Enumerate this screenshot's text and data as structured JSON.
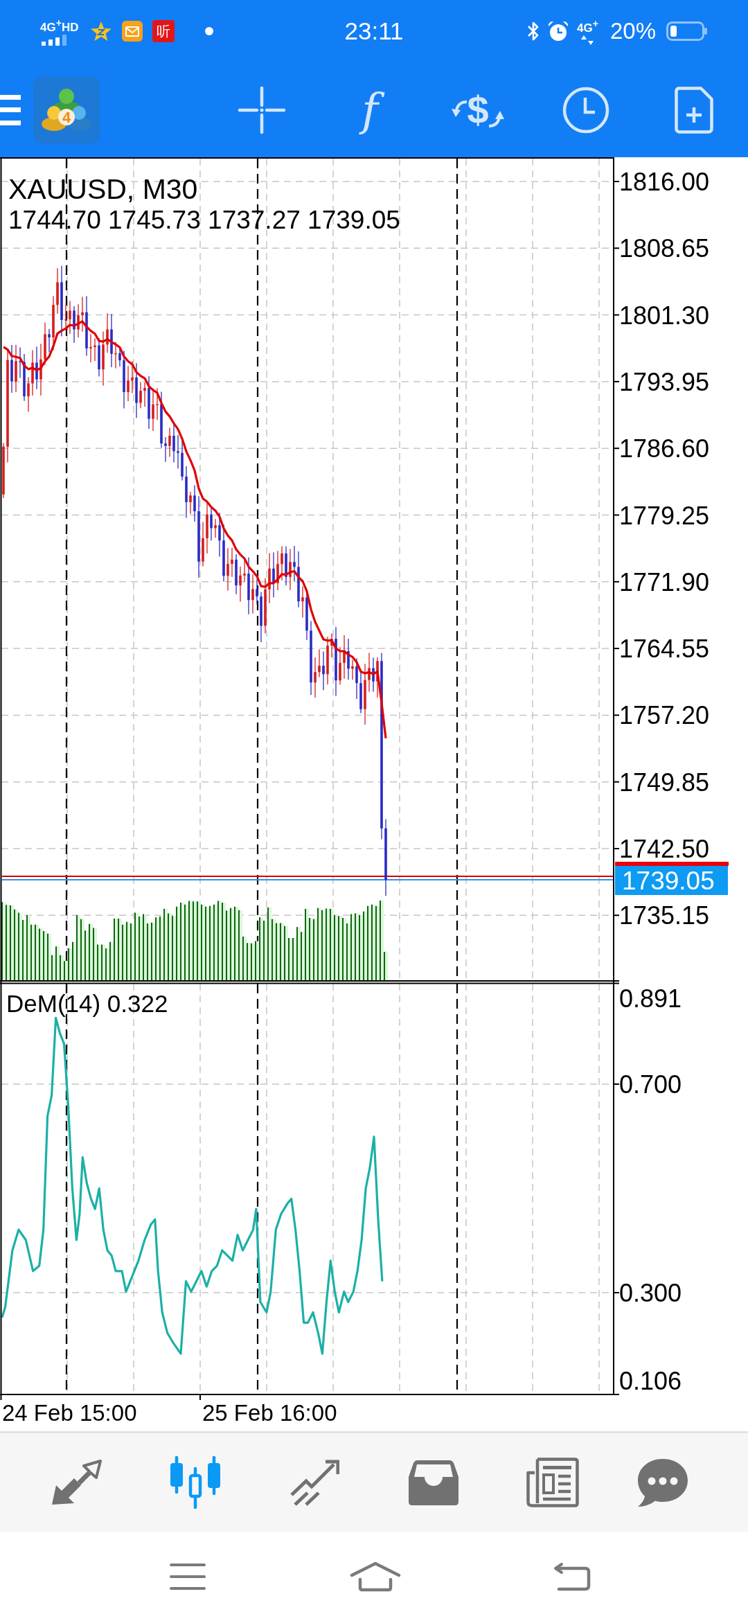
{
  "status_bar": {
    "network_label": "4G$^{+}$HD",
    "notification_badge": "听",
    "time": "23:11",
    "data_label": "4G$^{+}$",
    "battery": "20%"
  },
  "toolbar": {
    "logo_text": "4",
    "function_glyph": "f",
    "trade_glyph": "$"
  },
  "chart": {
    "title": "XAUUSD, M30",
    "ohlc": "1744.70 1745.73 1737.27 1739.05",
    "price_axis": [
      "1816.00",
      "1808.65",
      "1801.30",
      "1793.95",
      "1786.60",
      "1779.25",
      "1771.90",
      "1764.55",
      "1757.20",
      "1749.85",
      "1742.50",
      "1735.15"
    ],
    "current_price": "1739.05",
    "indicator_label": "DeM(14) 0.322",
    "indicator_axis": [
      "0.891",
      "0.700",
      "0.300",
      "0.106"
    ],
    "time_axis": [
      "24 Feb 15:00",
      "25 Feb 16:00"
    ]
  },
  "bottom_nav": [
    {
      "kind": "arrows",
      "selected": false
    },
    {
      "kind": "candles",
      "selected": true
    },
    {
      "kind": "trend",
      "selected": false
    },
    {
      "kind": "tray",
      "selected": false
    },
    {
      "kind": "newspaper",
      "selected": false
    },
    {
      "kind": "chat",
      "selected": false
    }
  ]
}
